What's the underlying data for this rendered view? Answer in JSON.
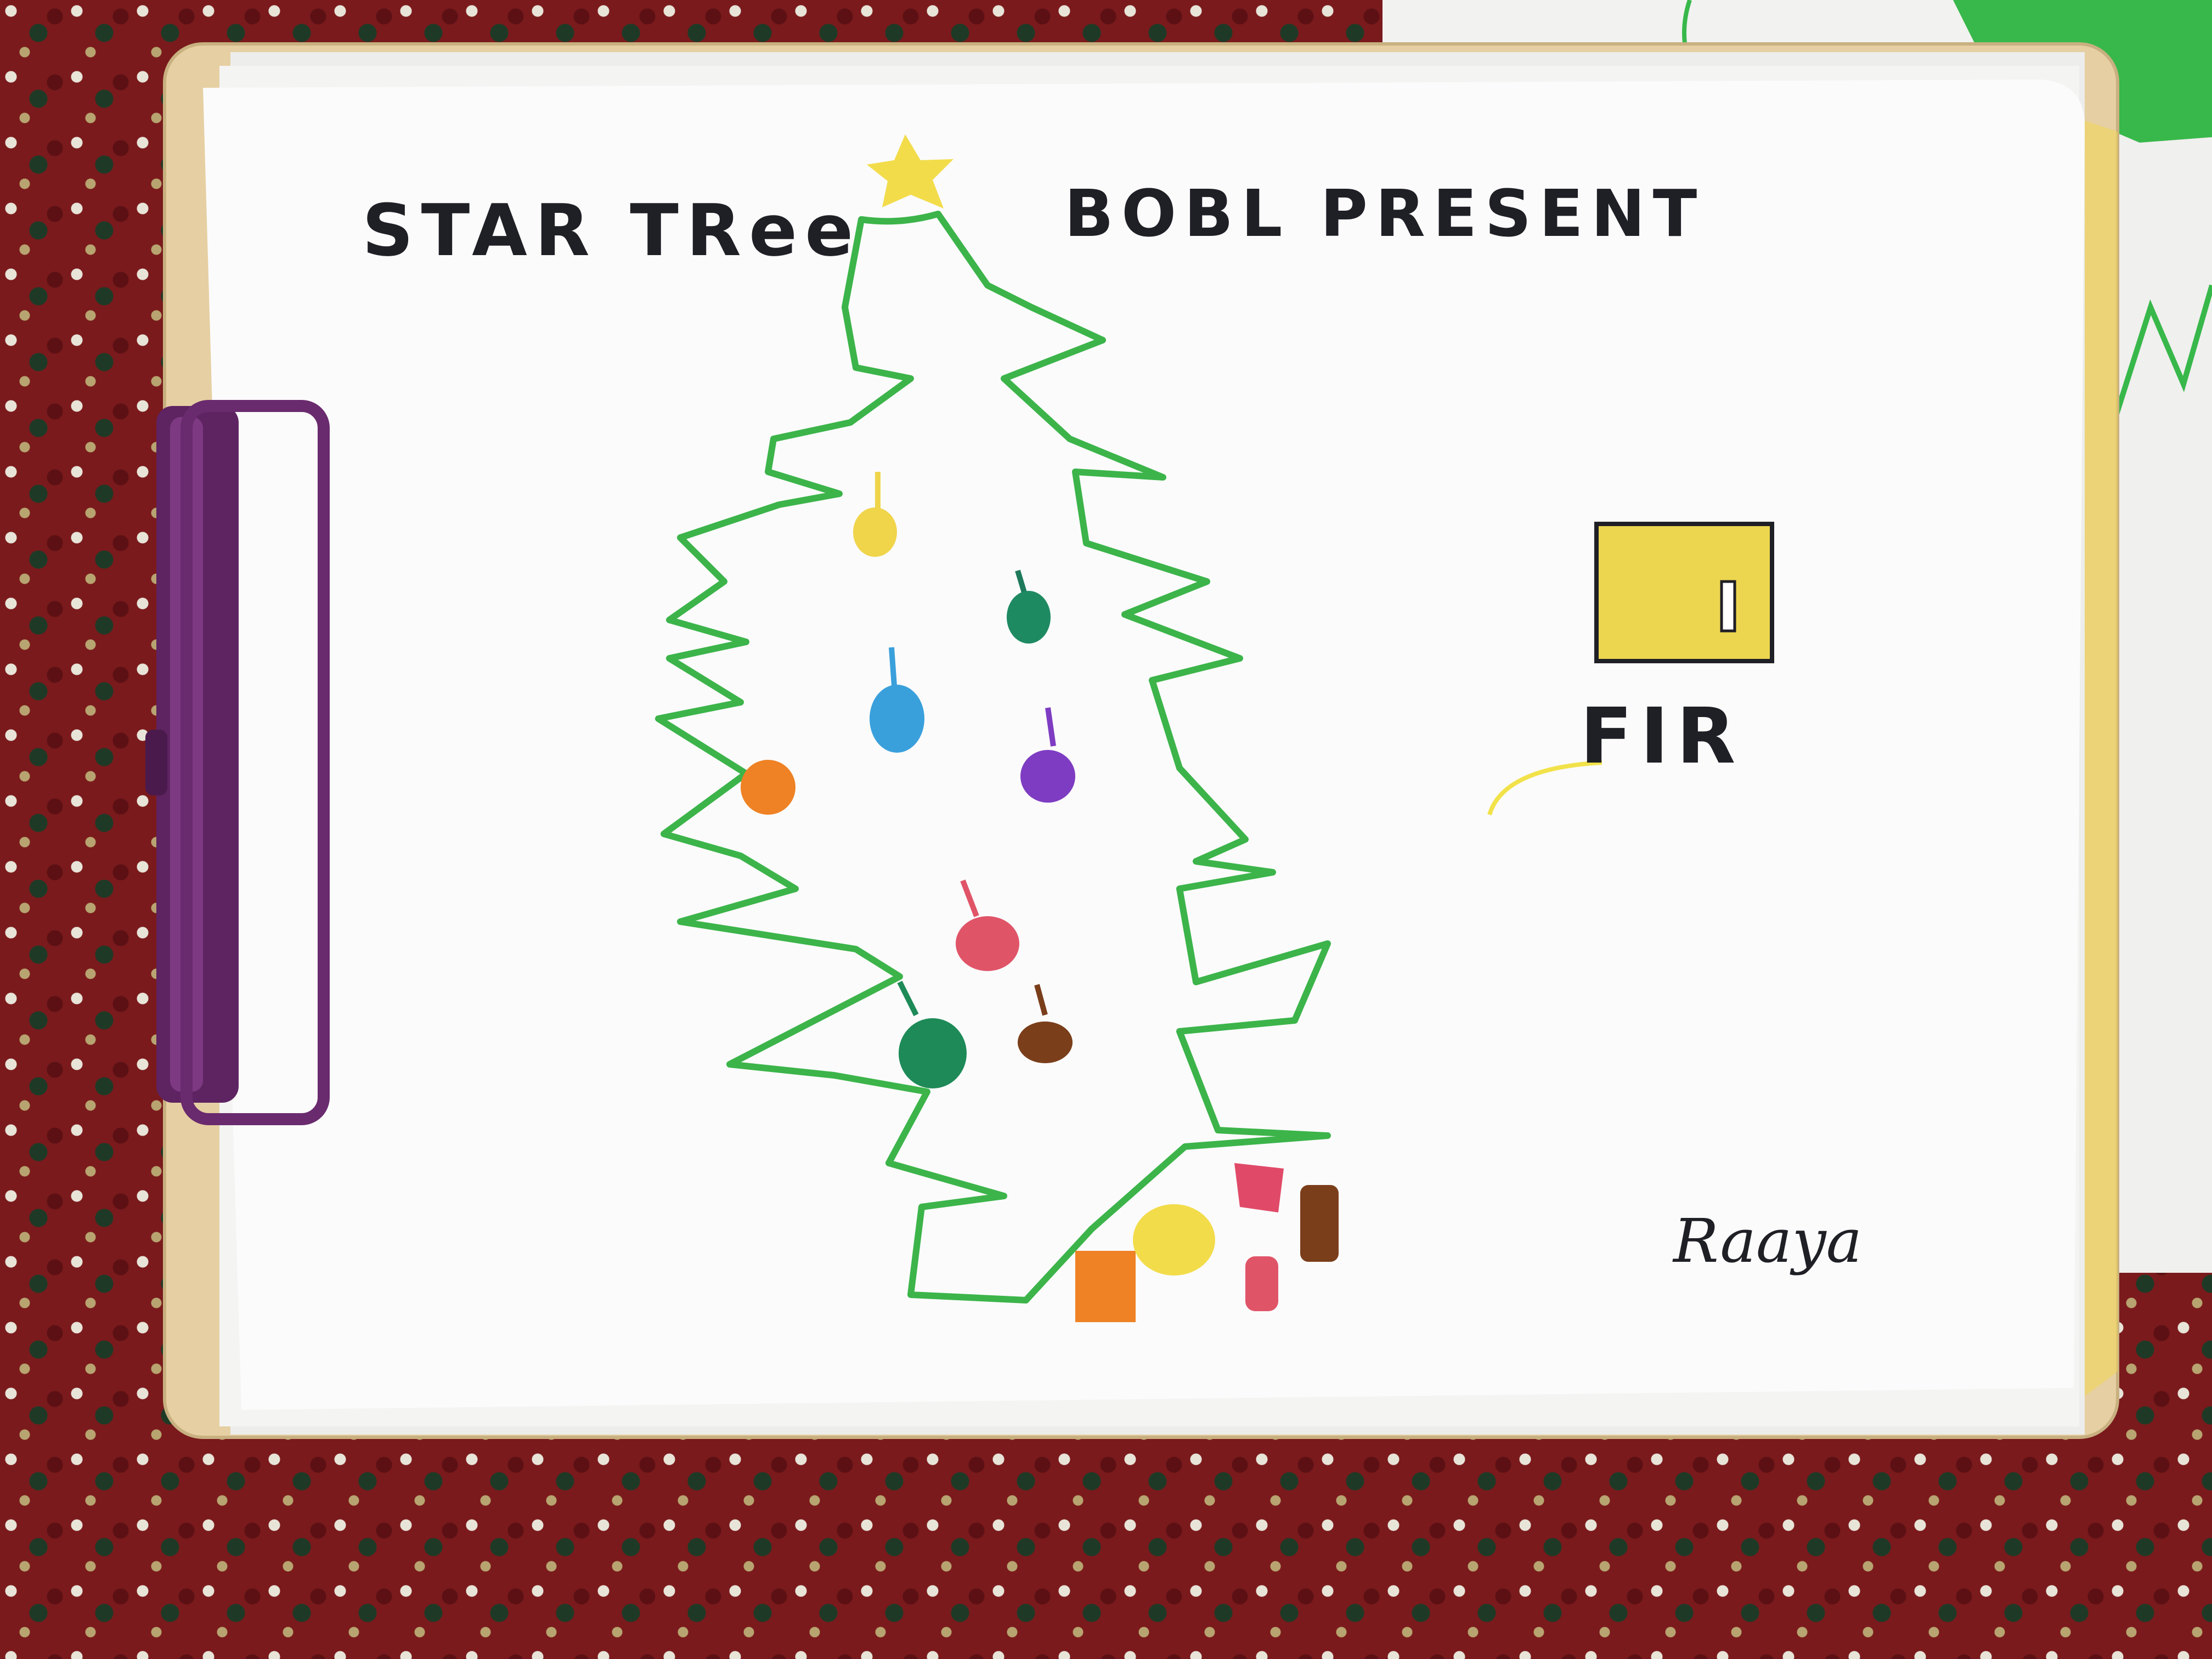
{
  "drawing": {
    "label_star_tree": "STAR TRee",
    "label_bobl_present": "BOBL PRESENT",
    "label_fir": "FIR",
    "signature": "Raaya"
  },
  "colors": {
    "carpet": "#7a1a1c",
    "clipboard": "#e6cfa2",
    "clip": "#6a2a6e",
    "paper": "#fbfbfb",
    "tree_outline": "#3cb44a",
    "star": "#f2dc4a",
    "present_box": "#ecd650",
    "ink": "#1f1f26"
  },
  "icons": [
    "star-icon",
    "tree-outline",
    "bauble-icon",
    "present-box-icon",
    "clip-icon"
  ]
}
